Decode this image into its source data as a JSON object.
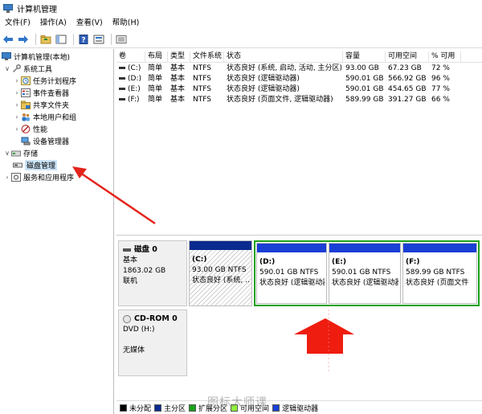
{
  "window": {
    "title": "计算机管理"
  },
  "menu": [
    "文件(F)",
    "操作(A)",
    "查看(V)",
    "帮助(H)"
  ],
  "tree": {
    "root": "计算机管理(本地)",
    "system_tools": "系统工具",
    "task_scheduler": "任务计划程序",
    "event_viewer": "事件查看器",
    "shared_folders": "共享文件夹",
    "local_users": "本地用户和组",
    "performance": "性能",
    "device_manager": "设备管理器",
    "storage": "存储",
    "disk_management": "磁盘管理",
    "services": "服务和应用程序"
  },
  "volumes": {
    "headers": [
      "卷",
      "布局",
      "类型",
      "文件系统",
      "状态",
      "容量",
      "可用空间",
      "% 可用"
    ],
    "rows": [
      [
        "(C:)",
        "简单",
        "基本",
        "NTFS",
        "状态良好 (系统, 启动, 活动, 主分区)",
        "93.00 GB",
        "67.23 GB",
        "72 %"
      ],
      [
        "(D:)",
        "简单",
        "基本",
        "NTFS",
        "状态良好 (逻辑驱动器)",
        "590.01 GB",
        "566.92 GB",
        "96 %"
      ],
      [
        "(E:)",
        "简单",
        "基本",
        "NTFS",
        "状态良好 (逻辑驱动器)",
        "590.01 GB",
        "454.65 GB",
        "77 %"
      ],
      [
        "(F:)",
        "简单",
        "基本",
        "NTFS",
        "状态良好 (页面文件, 逻辑驱动器)",
        "589.99 GB",
        "391.27 GB",
        "66 %"
      ]
    ]
  },
  "disk0": {
    "name": "磁盘 0",
    "type": "基本",
    "size": "1863.02 GB",
    "status": "联机",
    "partitions": [
      {
        "name": "(C:)",
        "size": "93.00 GB NTFS",
        "status": "状态良好 (系统, ..."
      },
      {
        "name": "(D:)",
        "size": "590.01 GB NTFS",
        "status": "状态良好 (逻辑驱动器)"
      },
      {
        "name": "(E:)",
        "size": "590.01 GB NTFS",
        "status": "状态良好 (逻辑驱动器)"
      },
      {
        "name": "(F:)",
        "size": "589.99 GB NTFS",
        "status": "状态良好 (页面文件"
      }
    ]
  },
  "cdrom": {
    "name": "CD-ROM 0",
    "type": "DVD (H:)",
    "status": "无媒体"
  },
  "legend": [
    "未分配",
    "主分区",
    "扩展分区",
    "可用空间",
    "逻辑驱动器"
  ],
  "watermark": "图标大师课",
  "colors": {
    "primary_partition": "#0b2a8f",
    "logical_drive": "#1a3fd4",
    "extended_partition": "#1aa11a",
    "unallocated": "#000000",
    "free_space": "#8fef3a",
    "arrow": "#e3241b",
    "selection": "#cce4f7"
  }
}
